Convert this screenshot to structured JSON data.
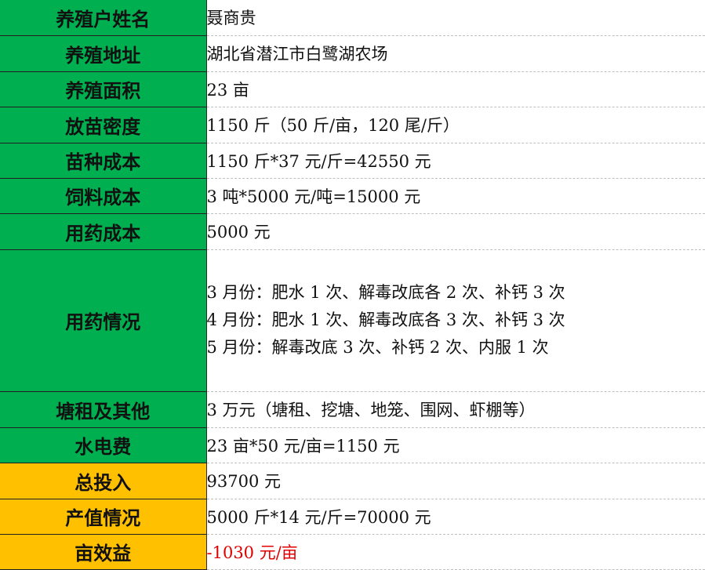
{
  "rows": [
    {
      "label": "养殖户姓名",
      "value": "聂商贵"
    },
    {
      "label": "养殖地址",
      "value": "湖北省潜江市白鹭湖农场"
    },
    {
      "label": "养殖面积",
      "value": "23 亩"
    },
    {
      "label": "放苗密度",
      "value": "1150 斤（50 斤/亩，120 尾/斤）"
    },
    {
      "label": "苗种成本",
      "value": "1150 斤*37 元/斤=42550 元"
    },
    {
      "label": "饲料成本",
      "value": "3 吨*5000 元/吨=15000 元"
    },
    {
      "label": "用药成本",
      "value": "5000 元"
    },
    {
      "label": "用药情况",
      "lines": [
        "3 月份：肥水 1 次、解毒改底各 2 次、补钙 3 次",
        "4 月份：肥水 1 次、解毒改底各 3 次、补钙 3 次",
        "5 月份：解毒改底 3 次、补钙 2 次、内服 1 次"
      ]
    },
    {
      "label": "塘租及其他",
      "value": "3 万元（塘租、挖塘、地笼、围网、虾棚等）"
    },
    {
      "label": "水电费",
      "value": "23 亩*50 元/亩=1150 元"
    },
    {
      "label": "总投入",
      "value": "93700 元"
    },
    {
      "label": "产值情况",
      "value": "5000 斤*14 元/斤=70000 元"
    },
    {
      "label": "亩效益",
      "value": "-1030 元/亩"
    }
  ],
  "colors": {
    "label_green": "#00b050",
    "label_gold": "#ffc000",
    "negative_text": "#e00000"
  }
}
